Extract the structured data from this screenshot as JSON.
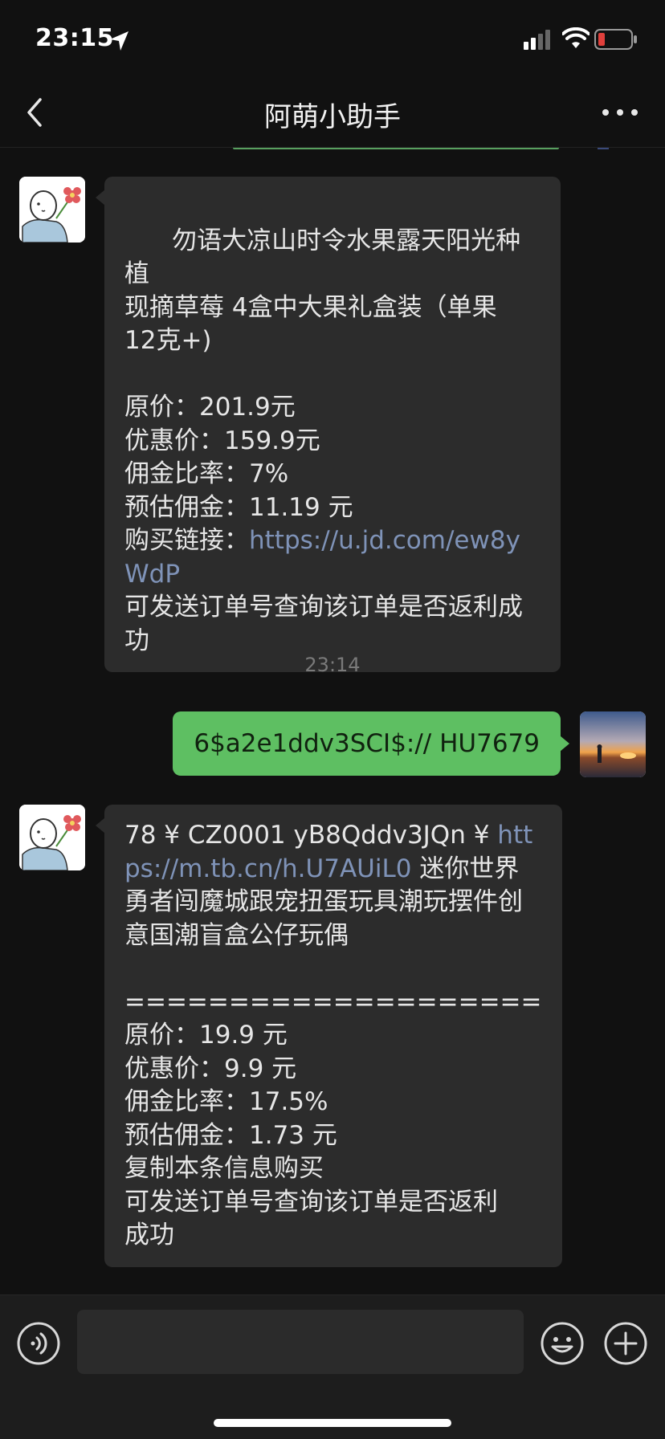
{
  "status_bar": {
    "time": "23:15",
    "icons": [
      "location-arrow-icon",
      "signal-icon",
      "wifi-icon",
      "battery-low-icon"
    ],
    "battery_color": "#e0403c"
  },
  "nav": {
    "title": "阿萌小助手",
    "back_icon": "chevron-left-icon",
    "more_icon": "more-dots-icon"
  },
  "messages": [
    {
      "direction": "incoming",
      "sender_avatar": "doodle-flower-avatar",
      "lines": [
        "勿语大凉山时令水果露天阳光种植",
        "现摘草莓 4盒中大果礼盒装（单果",
        "12克+)",
        "",
        "原价：201.9元",
        "优惠价：159.9元",
        "佣金比率：7%",
        "预估佣金：11.19 元"
      ],
      "link_prefix": "购买链接：",
      "link": "https://u.jd.com/ew8yWdP",
      "footer": "可发送订单号查询该订单是否返利成功"
    },
    {
      "type": "timestamp",
      "text": "23:14"
    },
    {
      "direction": "outgoing",
      "text": "6$a2e1ddv3SCI$:// HU7679",
      "sender_avatar": "sunset-photo-avatar"
    },
    {
      "direction": "incoming",
      "sender_avatar": "doodle-flower-avatar",
      "lead": "78 ¥ CZ0001 yB8Qddv3JQn ¥",
      "link": "https://m.tb.cn/h.U7AUiL0",
      "title": "迷你世界勇者闯魔城跟宠扭蛋玩具潮玩摆件创意国潮盲盒公仔玩偶",
      "separator": "====================",
      "details": [
        "原价：19.9 元",
        "优惠价：9.9 元",
        "佣金比率：17.5%",
        "预估佣金：1.73 元",
        "复制本条信息购买",
        "可发送订单号查询该订单是否返利",
        "成功"
      ]
    }
  ],
  "input_bar": {
    "voice_icon": "voice-icon",
    "emoji_icon": "emoji-icon",
    "plus_icon": "plus-icon",
    "placeholder": ""
  },
  "colors": {
    "background": "#111111",
    "incoming_bubble": "#2c2c2c",
    "outgoing_bubble": "#5ebf62",
    "link": "#7f93b8"
  }
}
